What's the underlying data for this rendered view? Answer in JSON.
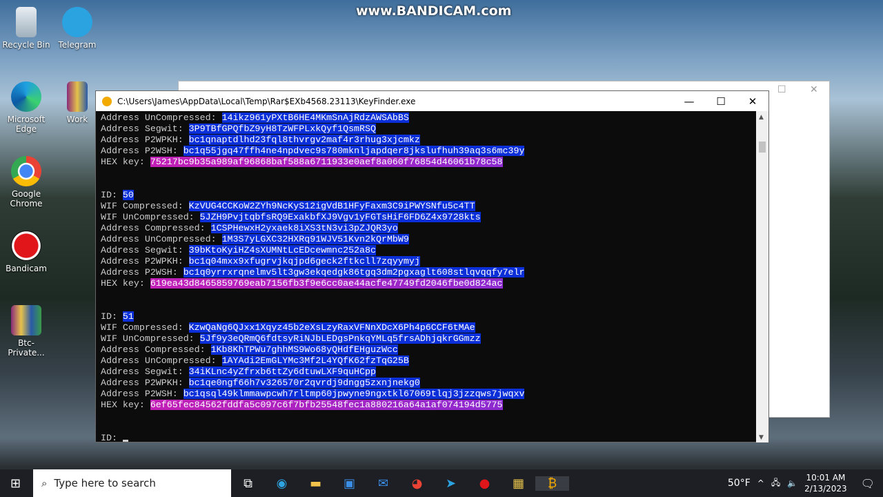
{
  "watermark": "www.BANDICAM.com",
  "desktop_icons": [
    {
      "label": "Recycle Bin"
    },
    {
      "label": "Telegram"
    },
    {
      "label": "Microsoft Edge"
    },
    {
      "label": "Work"
    },
    {
      "label": "Google Chrome"
    },
    {
      "label": "Bandicam"
    },
    {
      "label": "Btc-Private..."
    }
  ],
  "window": {
    "title": "C:\\Users\\James\\AppData\\Local\\Temp\\Rar$EXb4568.23113\\KeyFinder.exe"
  },
  "console": {
    "top": [
      {
        "label": "Address UnCompressed: ",
        "value": "14ikz961yPXtB6HE4MKmSnAjRdzAWSAbBS"
      },
      {
        "label": "Address Segwit: ",
        "value": "3P9TBfGPQfbZ9yH8TzWFPLxkQyf1QsmRSQ"
      },
      {
        "label": "Address P2WPKH: ",
        "value": "bc1qnaptdlhd23fql8thvrgv2maf4r3rhug3xjcmkz"
      },
      {
        "label": "Address P2WSH: ",
        "value": "bc1q55jgq47ffh4ne4npdvec9s780mknljapdqer8jkslufhuh39aq3s6mc39y"
      },
      {
        "label": "HEX key: ",
        "value": "75217bc9b35a989af96868baf588a6711933e0aef8a060f76854d46061b78c58",
        "hex": true
      }
    ],
    "blocks": [
      {
        "id": "50",
        "rows": [
          {
            "label": "WIF Compressed: ",
            "value": "KzVUG4CCKoW2ZYh9NcKyS12igVdB1HFyFaxm3C9iPWYSNfu5c4TT"
          },
          {
            "label": "WIF UnCompressed: ",
            "value": "5JZH9PvjtqbfsRQ9ExakbfXJ9Vgv1yFGTsHiF6FD6Z4x9728kts"
          },
          {
            "label": "Address Compressed: ",
            "value": "1CSPHewxH2yxaek8iXS3tN3vi3pZJQR3yo"
          },
          {
            "label": "Address UnCompressed: ",
            "value": "1M3S7yLGXC32HXRq91WJV51Kvn2kQrMbW9"
          },
          {
            "label": "Address Segwit: ",
            "value": "39bKtoKyiHZ4sXUMNtLcEDcewmnc252a8c"
          },
          {
            "label": "Address P2WPKH: ",
            "value": "bc1q04mxx9xfugrvjkqjpd6geck2ftkcll7zqyymyj"
          },
          {
            "label": "Address P2WSH: ",
            "value": "bc1q0yrrxrqnelmv5lt3gw3ekqedgk86tgq3dm2pgxaglt608stlqvqqfy7elr"
          },
          {
            "label": "HEX key: ",
            "value": "619ea43d8465859769eab7156fb3f9e6cc0ae44acfe47749fd2046fbe0d824ac",
            "hex": true
          }
        ]
      },
      {
        "id": "51",
        "rows": [
          {
            "label": "WIF Compressed: ",
            "value": "KzwQaNg6QJxx1Xqyz45b2eXsLzyRaxVFNnXDcX6Ph4p6CCF6tMAe"
          },
          {
            "label": "WIF UnCompressed: ",
            "value": "5Jf9y3eQRmQ6fdtsyRiNJbLEDgsPnkqYMLq5frsADhjqkrGGmzz"
          },
          {
            "label": "Address Compressed: ",
            "value": "1Kb8KhTPWu7ghhMS9Wo68yQHdfEHguzWcc"
          },
          {
            "label": "Address UnCompressed: ",
            "value": "1AYAdi2EmGLYMc3Mf2L4YQfK62fzTqG25B"
          },
          {
            "label": "Address Segwit: ",
            "value": "34iKLnc4yZfrxb6ttZy6dtuwLXF9quHCpp"
          },
          {
            "label": "Address P2WPKH: ",
            "value": "bc1qe0ngf66h7v326570r2qvrdj9dngg5zxnjnekg0"
          },
          {
            "label": "Address P2WSH: ",
            "value": "bc1qsql49klmmawpcwh7rltmp60jpwyne9ngxtkl67069tlqj3jzzqws7jwqxv"
          },
          {
            "label": "HEX key: ",
            "value": "6ef65fec84562fddfa5c097c6f7bfb25548fec1a880216a64a1af074194d5775",
            "hex": true
          }
        ]
      }
    ],
    "id_label": "ID: ",
    "prompt": "ID: "
  },
  "taskbar": {
    "search_placeholder": "Type here to search",
    "weather": "50°F",
    "time": "10:01 AM",
    "date": "2/13/2023"
  },
  "colors": {
    "selection": "#0b2fd8",
    "hex_highlight": "#c21fb6"
  }
}
